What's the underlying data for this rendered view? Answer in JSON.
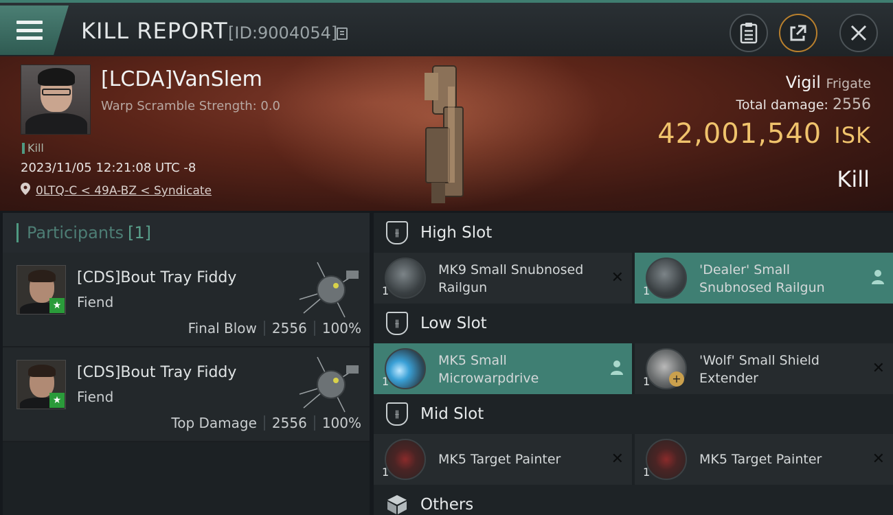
{
  "header": {
    "title": "KILL REPORT",
    "report_id": "[ID:9004054]"
  },
  "victim": {
    "name": "[LCDA]VanSlem",
    "warp_scramble": "Warp Scramble Strength: 0.0",
    "tag": "Kill",
    "timestamp": "2023/11/05 12:21:08 UTC -8",
    "location": "0LTQ-C < 49A-BZ < Syndicate",
    "ship": "Vigil",
    "ship_class": "Frigate",
    "total_damage_label": "Total damage:",
    "total_damage": "2556",
    "isk_value": "42,001,540",
    "isk_unit": "ISK",
    "kill_type": "Kill"
  },
  "participants": {
    "title": "Participants",
    "count": "[1]",
    "rows": [
      {
        "name": "[CDS]Bout Tray Fiddy",
        "ship": "Fiend",
        "role": "Final Blow",
        "damage": "2556",
        "percent": "100%"
      },
      {
        "name": "[CDS]Bout Tray Fiddy",
        "ship": "Fiend",
        "role": "Top Damage",
        "damage": "2556",
        "percent": "100%"
      }
    ]
  },
  "fittings": {
    "high_slot": {
      "label": "High Slot",
      "modules": [
        {
          "qty": "1",
          "name": "MK9 Small Snubnosed Railgun",
          "status": "destroyed"
        },
        {
          "qty": "1",
          "name": "'Dealer' Small Snubnosed Railgun",
          "status": "dropped"
        }
      ]
    },
    "low_slot": {
      "label": "Low Slot",
      "modules": [
        {
          "qty": "1",
          "name": "MK5 Small Microwarpdrive",
          "status": "dropped"
        },
        {
          "qty": "1",
          "name": "'Wolf' Small Shield Extender",
          "status": "destroyed"
        }
      ]
    },
    "mid_slot": {
      "label": "Mid Slot",
      "modules": [
        {
          "qty": "1",
          "name": "MK5 Target Painter",
          "status": "destroyed"
        },
        {
          "qty": "1",
          "name": "MK5 Target Painter",
          "status": "destroyed"
        }
      ]
    },
    "others": {
      "label": "Others"
    }
  },
  "icons": {
    "menu": "hamburger-icon",
    "copy": "copy-icon",
    "notes": "clipboard-icon",
    "share": "share-icon",
    "close": "close-icon",
    "location": "pin-icon",
    "destroyed": "x-icon",
    "dropped": "person-icon"
  },
  "colors": {
    "accent": "#4f9a82",
    "highlight": "#3f7f73",
    "isk": "#f0c36c",
    "share_ring": "#b9802d"
  }
}
